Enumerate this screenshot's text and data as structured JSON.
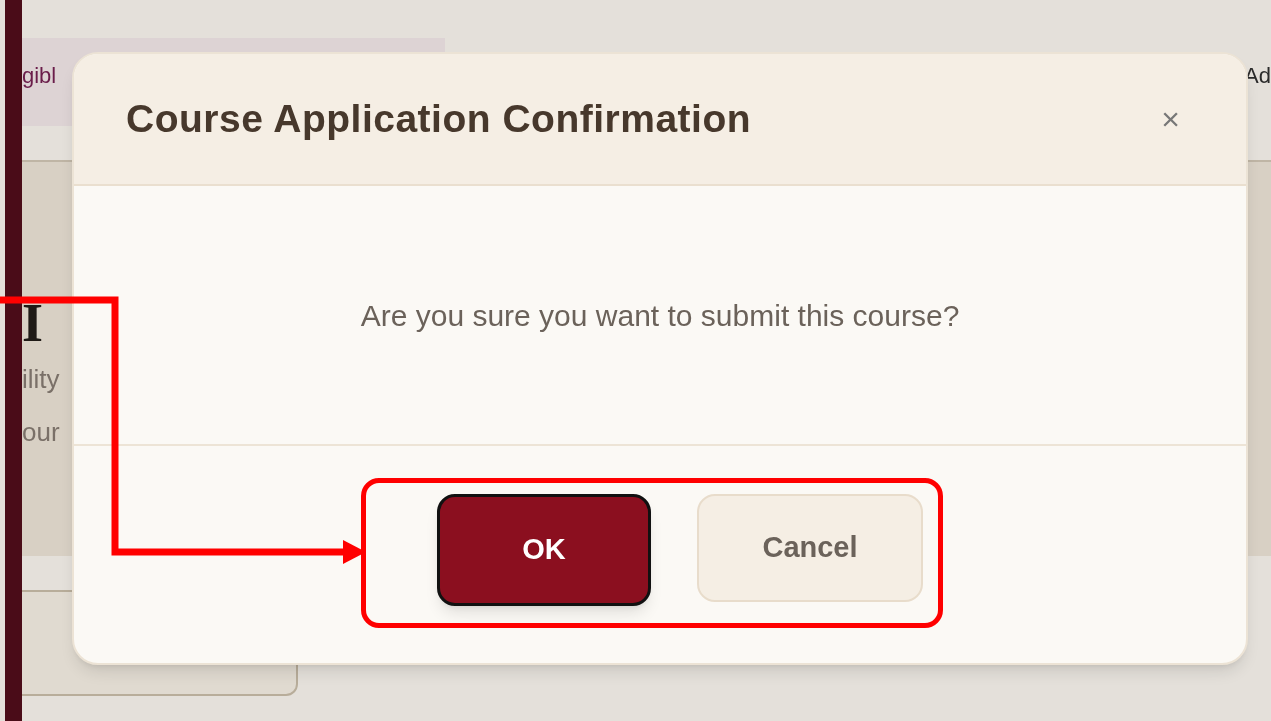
{
  "background": {
    "tab_fragment_left": "gibl",
    "tab_fragment_right": "Ad",
    "heading_fragment": "I",
    "text_fragments": [
      "ility",
      "our"
    ]
  },
  "dialog": {
    "title": "Course Application Confirmation",
    "close": "×",
    "message": "Are you sure you want to submit this course?",
    "buttons": [
      {
        "label": "OK",
        "kind": "primary"
      },
      {
        "label": "Cancel",
        "kind": "secondary"
      }
    ]
  }
}
